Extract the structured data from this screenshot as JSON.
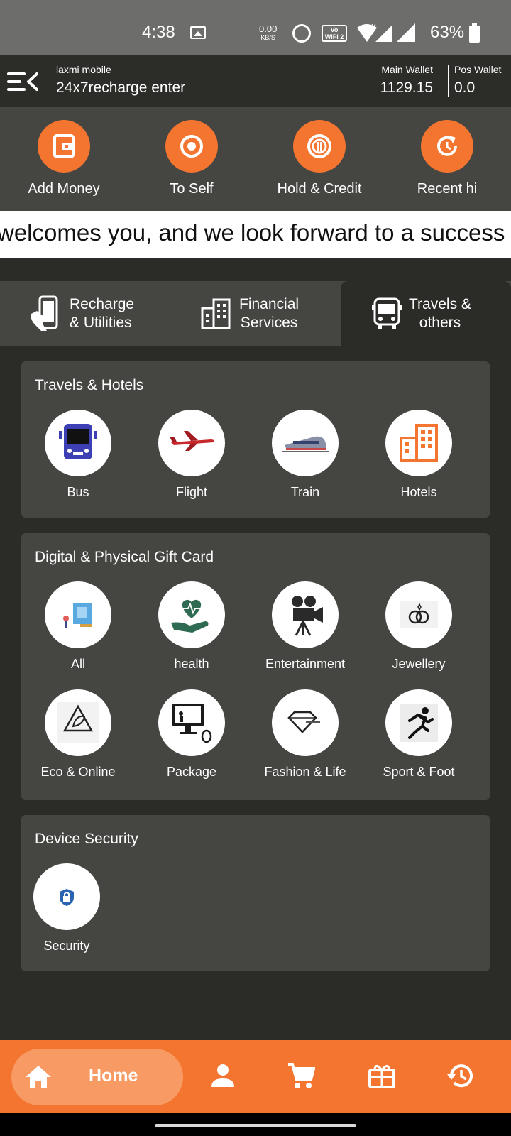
{
  "status_bar": {
    "time": "4:38",
    "net_speed": "0.00",
    "net_speed_unit": "KB/S",
    "wifi_badge_top": "Vo",
    "wifi_badge_bottom": "WiFi 2",
    "battery": "63%"
  },
  "header": {
    "shop_name": "laxmi mobile",
    "shop_id": "24x7recharge enter",
    "main_wallet_label": "Main Wallet",
    "main_wallet_value": "1129.15",
    "pos_wallet_label": "Pos Wallet",
    "pos_wallet_value": "0.0"
  },
  "quick_actions": [
    {
      "label": "Add Money",
      "icon": "wallet-icon"
    },
    {
      "label": "To Self",
      "icon": "self-transfer-icon"
    },
    {
      "label": "Hold & Credit",
      "icon": "hold-credit-icon"
    },
    {
      "label": "Recent hi",
      "icon": "recent-history-icon"
    }
  ],
  "marquee": "welcomes you, and we look forward to a success",
  "tabs": [
    {
      "label_line1": "Recharge",
      "label_line2": "& Utilities",
      "icon": "mobile-hand-icon"
    },
    {
      "label_line1": "Financial",
      "label_line2": "Services",
      "icon": "building-icon"
    },
    {
      "label_line1": "Travels &",
      "label_line2": "others",
      "icon": "bus-icon"
    }
  ],
  "sections": {
    "travels": {
      "title": "Travels & Hotels",
      "items": [
        {
          "label": "Bus",
          "icon": "bus-icon"
        },
        {
          "label": "Flight",
          "icon": "airplane-icon"
        },
        {
          "label": "Train",
          "icon": "train-icon"
        },
        {
          "label": "Hotels",
          "icon": "hotel-icon"
        }
      ]
    },
    "giftcards": {
      "title": "Digital & Physical Gift Card",
      "items": [
        {
          "label": "All",
          "icon": "all-cards-icon"
        },
        {
          "label": "health",
          "icon": "health-icon"
        },
        {
          "label": "Entertainment",
          "icon": "movie-camera-icon"
        },
        {
          "label": "Jewellery",
          "icon": "rings-icon"
        },
        {
          "label": "Eco & Online",
          "icon": "recycle-icon"
        },
        {
          "label": "Package",
          "icon": "computer-package-icon"
        },
        {
          "label": "Fashion & Life",
          "icon": "fashion-diamond-icon"
        },
        {
          "label": "Sport & Foot",
          "icon": "runner-icon"
        }
      ]
    },
    "security": {
      "title": "Device Security",
      "items": [
        {
          "label": "Security",
          "icon": "shield-lock-icon"
        }
      ]
    }
  },
  "bottom_nav": {
    "home_label": "Home",
    "items": [
      "home-icon",
      "profile-icon",
      "cart-icon",
      "gift-icon",
      "history-icon"
    ]
  },
  "colors": {
    "accent": "#f47530",
    "panel": "#454542",
    "background": "#2b2b28"
  }
}
